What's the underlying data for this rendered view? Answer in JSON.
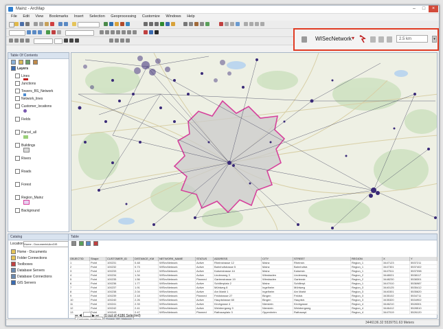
{
  "window": {
    "title": "Mainz - ArcMap",
    "minimize": "–",
    "maximize": "□",
    "close": "×"
  },
  "menu": [
    "File",
    "Edit",
    "View",
    "Bookmarks",
    "Insert",
    "Selection",
    "Geoprocessing",
    "Customize",
    "Windows",
    "Help"
  ],
  "wisenetwork_toolbar": {
    "network_label": "WISecNetwork",
    "distance_value": "2.5 km",
    "dropdown_arrow": "▾"
  },
  "toc": {
    "title": "Table Of Contents",
    "layers": [
      "Layers",
      "Lines",
      "Junctions",
      "Towers_BS_Network",
      "Network_lines",
      "Customer_locations",
      "Fields",
      "Parcel_all",
      "Buildings",
      "Rivers",
      "Roads",
      "Forest",
      "Region_Mainz",
      "Background"
    ]
  },
  "catalog": {
    "title": "Catalog",
    "location_label": "Location:",
    "location_value": "Home - Documents\\ArcGIS",
    "items": [
      "Home - Documents",
      "Folder Connections",
      "Toolboxes",
      "Database Servers",
      "Database Connections",
      "GIS Servers"
    ]
  },
  "table": {
    "title": "Table",
    "columns": [
      "OBJECTID",
      "Shape",
      "CUSTOMER_ID",
      "DISTANCE_KM",
      "NETWORK_NAME",
      "STATUS",
      "ADDRESS",
      "CITY",
      "STREET",
      "REGION",
      "X",
      "Y"
    ],
    "rows": [
      [
        "1",
        "Point",
        "100231",
        "0.48",
        "WISecNetwork",
        "Active",
        "Rheinstrasse 12",
        "Mainz",
        "Rheinstr.",
        "Region_1",
        "3447123",
        "5537211"
      ],
      [
        "2",
        "Point",
        "100232",
        "0.73",
        "WISecNetwork",
        "Active",
        "Bahnhofstrasse 5",
        "Mainz",
        "Bahnhofstr.",
        "Region_1",
        "3447301",
        "5537402"
      ],
      [
        "3",
        "Point",
        "100233",
        "1.12",
        "WISecNetwork",
        "Active",
        "Kaiserstrasse 44",
        "Mainz",
        "Kaiserstr.",
        "Region_1",
        "3447511",
        "5537098"
      ],
      [
        "4",
        "Point",
        "100234",
        "1.34",
        "WISecNetwork",
        "Active",
        "Lindenweg 3",
        "Wiesbaden",
        "Lindenweg",
        "Region_2",
        "3448021",
        "5538117"
      ],
      [
        "5",
        "Point",
        "100235",
        "1.56",
        "WISecNetwork",
        "Planned",
        "Gartenstrasse 19",
        "Wiesbaden",
        "Gartenstr.",
        "Region_2",
        "3448230",
        "5538301"
      ],
      [
        "6",
        "Point",
        "100236",
        "1.77",
        "WISecNetwork",
        "Active",
        "Schillerplatz 2",
        "Mainz",
        "Schillerpl.",
        "Region_1",
        "3447010",
        "5536987"
      ],
      [
        "7",
        "Point",
        "100237",
        "1.91",
        "WISecNetwork",
        "Active",
        "Mühlweg 8",
        "Ingelheim",
        "Mühlweg",
        "Region_3",
        "3440125",
        "5535412"
      ],
      [
        "8",
        "Point",
        "100238",
        "2.04",
        "WISecNetwork",
        "Active",
        "Am Markt 1",
        "Ingelheim",
        "Am Markt",
        "Region_3",
        "3440301",
        "5535620"
      ],
      [
        "9",
        "Point",
        "100239",
        "2.18",
        "WISecNetwork",
        "Planned",
        "Feldstrasse 27",
        "Bingen",
        "Feldstr.",
        "Region_3",
        "3435102",
        "5534711"
      ],
      [
        "10",
        "Point",
        "100240",
        "2.26",
        "WISecNetwork",
        "Active",
        "Hauptstrasse 60",
        "Bingen",
        "Hauptstr.",
        "Region_3",
        "3435320",
        "5534902"
      ],
      [
        "11",
        "Point",
        "100241",
        "2.33",
        "WISecNetwork",
        "Active",
        "Kirchgasse 4",
        "Nierstein",
        "Kirchgasse",
        "Region_4",
        "3446210",
        "5528301"
      ],
      [
        "12",
        "Point",
        "100242",
        "2.41",
        "WISecNetwork",
        "Active",
        "Weinbergweg 9",
        "Nierstein",
        "Weinbergweg",
        "Region_4",
        "3446412",
        "5528510"
      ],
      [
        "13",
        "Point",
        "100243",
        "2.47",
        "WISecNetwork",
        "Planned",
        "Rathausplatz 3",
        "Oppenheim",
        "Rathauspl.",
        "Region_4",
        "3447019",
        "5526120"
      ]
    ],
    "pager_text": "(0 out of 4186 Selected)",
    "tabs": [
      "Customer_locations",
      "Towers_BS_Network"
    ]
  },
  "status": {
    "coords": "3446136.32  5539751.63 Meters"
  },
  "colors": {
    "highlight": "#e03a22",
    "boundary": "#d6419c",
    "points": "#3a2a78",
    "network_lines": "#3c3c5a"
  }
}
